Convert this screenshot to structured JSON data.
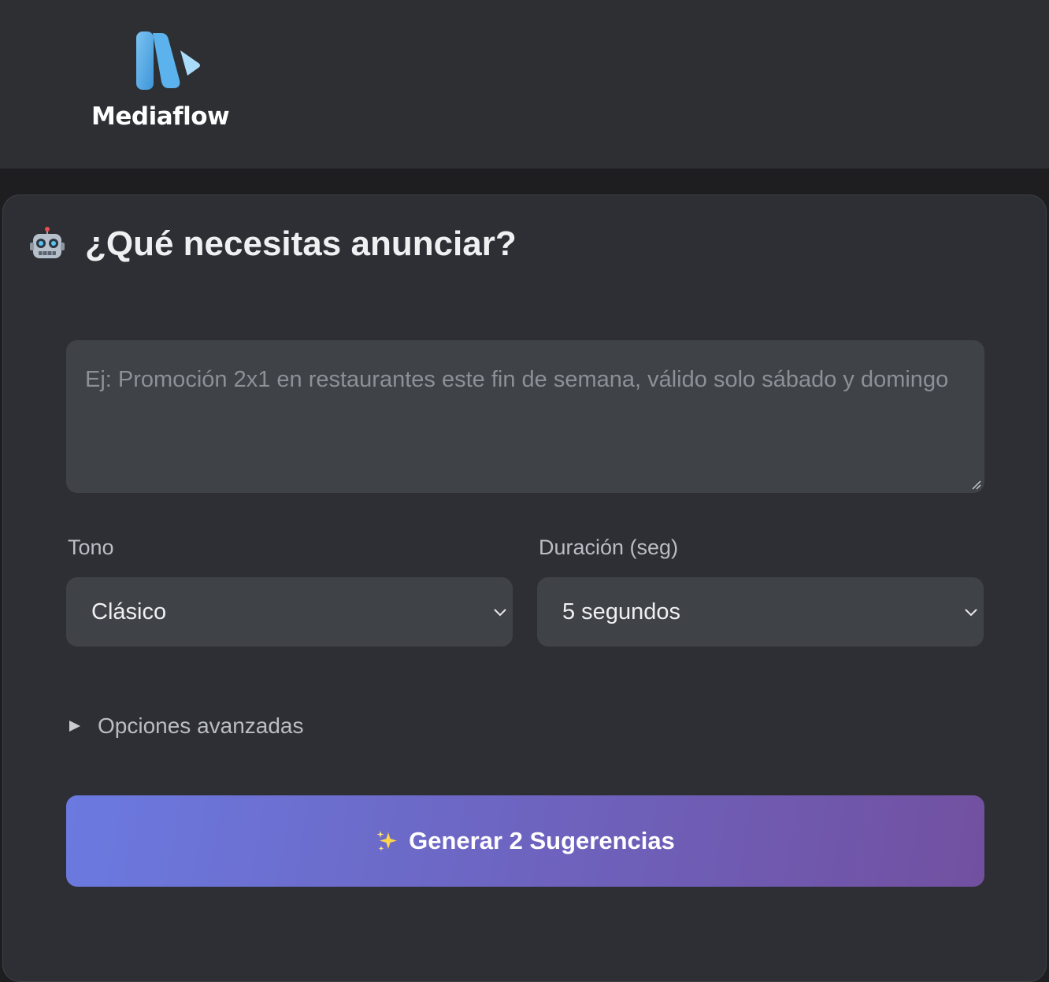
{
  "header": {
    "logo_text": "Mediaflow",
    "logo_icon": "mediaflow-logo-icon",
    "brand_color": "#5aaee8"
  },
  "card": {
    "title_icon": "robot-icon",
    "title": "¿Qué necesitas anunciar?",
    "description_input": {
      "value": "",
      "placeholder": "Ej: Promoción 2x1 en restaurantes este fin de semana, válido solo sábado y domingo"
    },
    "tone": {
      "label": "Tono",
      "selected": "Clásico"
    },
    "duration": {
      "label": "Duración (seg)",
      "selected": "5 segundos"
    },
    "advanced": {
      "label": "Opciones avanzadas",
      "expanded": false
    },
    "generate_button": {
      "icon": "sparkles-icon",
      "label": "Generar 2 Sugerencias",
      "gradient": [
        "#6b7ae0",
        "#7250a0"
      ]
    }
  }
}
